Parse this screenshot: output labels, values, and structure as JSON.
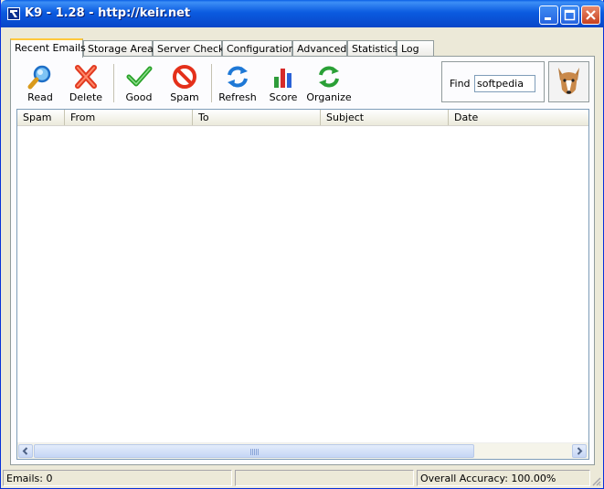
{
  "window": {
    "title": "K9 - 1.28 - http://keir.net"
  },
  "tabs": [
    {
      "label": "Recent Emails",
      "active": true
    },
    {
      "label": "Storage Area"
    },
    {
      "label": "Server Check"
    },
    {
      "label": "Configuration"
    },
    {
      "label": "Advanced"
    },
    {
      "label": "Statistics"
    },
    {
      "label": "Log"
    }
  ],
  "toolbar": {
    "read": {
      "label": "Read",
      "icon": "magnifier-icon"
    },
    "delete": {
      "label": "Delete",
      "icon": "red-x-icon"
    },
    "good": {
      "label": "Good",
      "icon": "green-check-icon"
    },
    "spam": {
      "label": "Spam",
      "icon": "no-entry-icon"
    },
    "refresh": {
      "label": "Refresh",
      "icon": "refresh-arrows-icon"
    },
    "score": {
      "label": "Score",
      "icon": "bar-chart-icon"
    },
    "organize": {
      "label": "Organize",
      "icon": "green-cycle-icon"
    }
  },
  "find": {
    "label": "Find",
    "value": "softpedia"
  },
  "list": {
    "columns": [
      "Spam",
      "From",
      "To",
      "Subject",
      "Date"
    ],
    "rows": []
  },
  "statusbar": {
    "emails": "Emails: 0",
    "middle": "",
    "accuracy": "Overall Accuracy: 100.00%"
  },
  "colors": {
    "titlebar": "#0a5fe6",
    "window_bg": "#ece9d8",
    "active_tab_accent": "#ffc83c"
  }
}
